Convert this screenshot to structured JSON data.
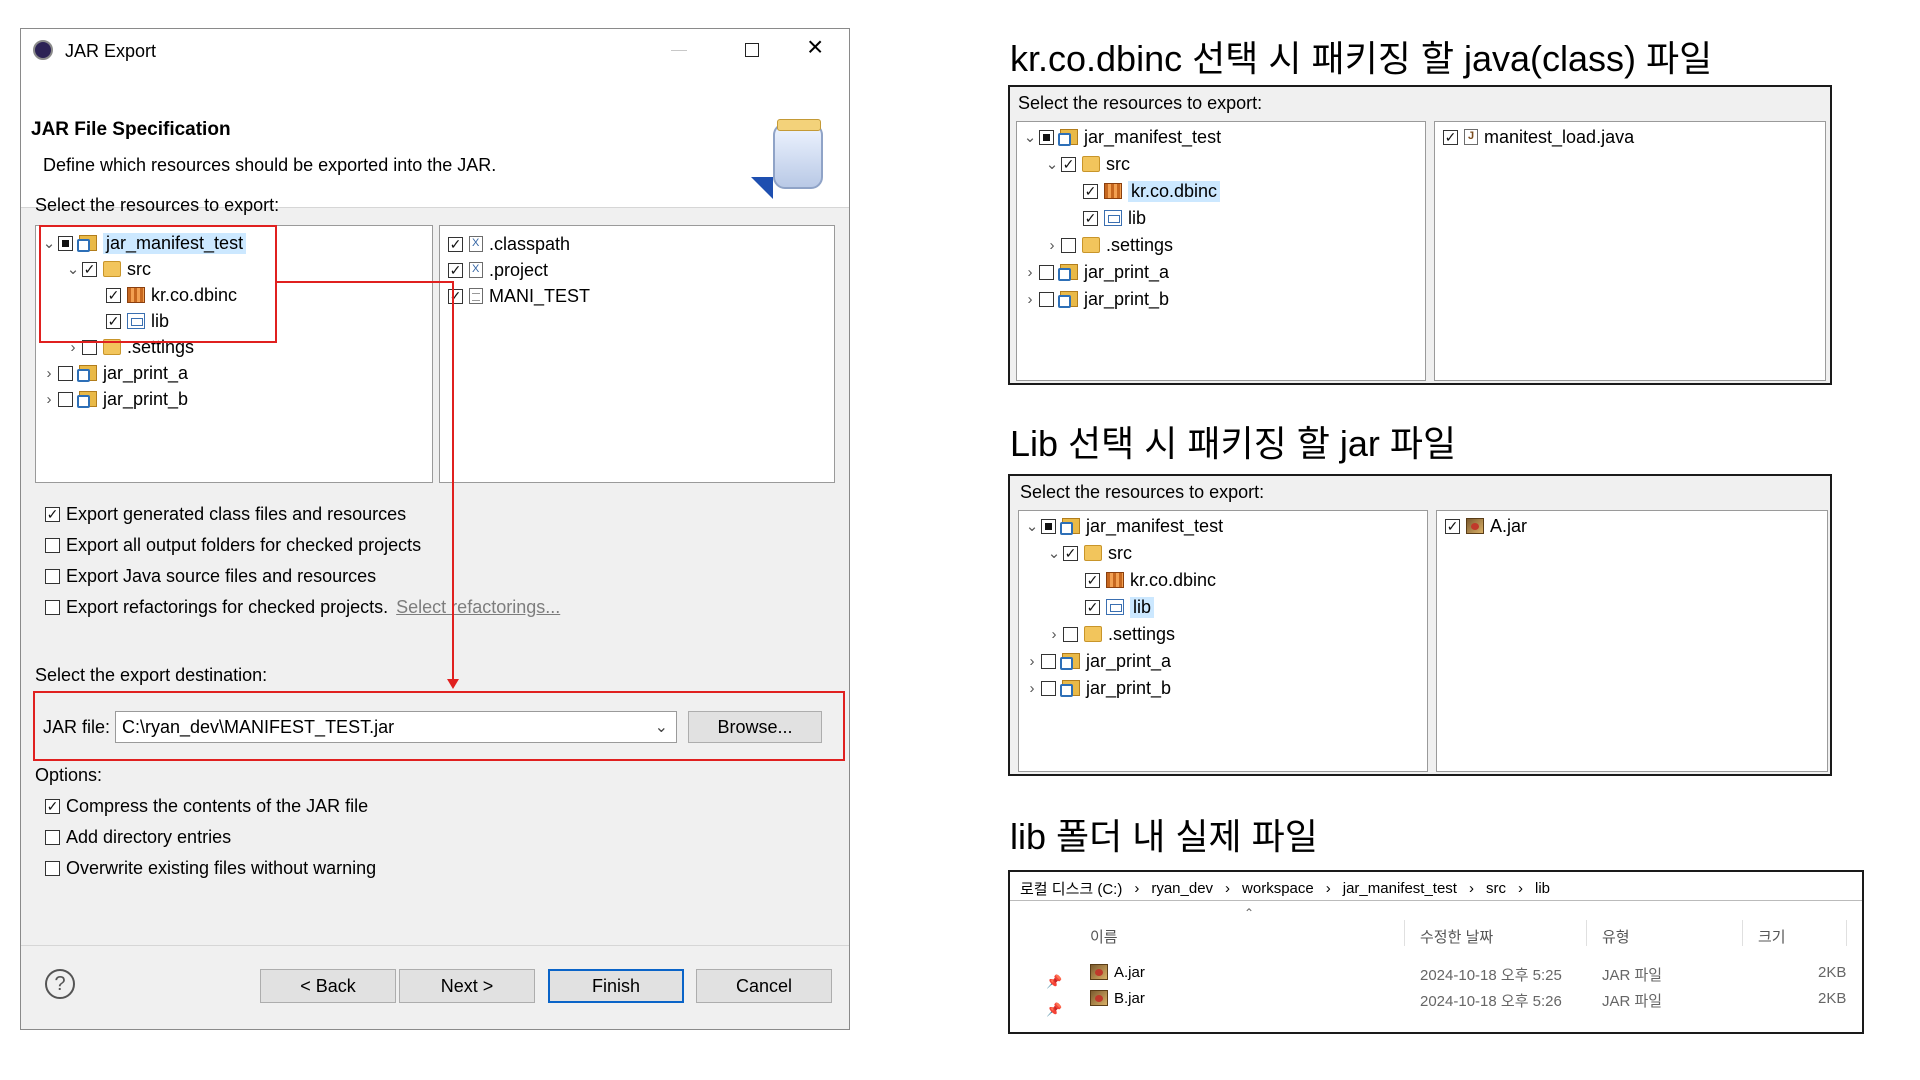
{
  "dialog": {
    "window_title": "JAR Export",
    "header_title": "JAR File Specification",
    "header_desc": "Define which resources should be exported into the JAR.",
    "select_label": "Select the resources to export:",
    "tree": [
      {
        "label": "jar_manifest_test",
        "state": "partial",
        "expand": "open"
      },
      {
        "label": "src",
        "state": "checked",
        "expand": "open"
      },
      {
        "label": "kr.co.dbinc",
        "state": "checked",
        "expand": "none"
      },
      {
        "label": "lib",
        "state": "checked",
        "expand": "none"
      },
      {
        "label": ".settings",
        "state": "unchecked",
        "expand": "closed"
      },
      {
        "label": "jar_print_a",
        "state": "unchecked",
        "expand": "closed"
      },
      {
        "label": "jar_print_b",
        "state": "unchecked",
        "expand": "closed"
      }
    ],
    "files": [
      ".classpath",
      ".project",
      "MANI_TEST"
    ],
    "opts1": [
      {
        "label": "Export generated class files and resources",
        "checked": true
      },
      {
        "label": "Export all output folders for checked projects",
        "checked": false
      },
      {
        "label": "Export Java source files and resources",
        "checked": false
      },
      {
        "label": "Export refactorings for checked projects.",
        "checked": false
      }
    ],
    "select_refactorings": "Select refactorings...",
    "dest_label": "Select the export destination:",
    "jar_file_label": "JAR file:",
    "jar_file_value": "C:\\ryan_dev\\MANIFEST_TEST.jar",
    "browse": "Browse...",
    "options_label": "Options:",
    "opts2": [
      {
        "label": "Compress the contents of the JAR file",
        "checked": true
      },
      {
        "label": "Add directory entries",
        "checked": false
      },
      {
        "label": "Overwrite existing files without warning",
        "checked": false
      }
    ],
    "back": "< Back",
    "next": "Next >",
    "finish": "Finish",
    "cancel": "Cancel"
  },
  "right": {
    "heading1": "kr.co.dbinc 선택 시 패키징 할 java(class) 파일",
    "heading2": "Lib 선택 시 패키징 할 jar 파일",
    "heading3": "lib 폴더 내 실제 파일",
    "select_label": "Select the resources to export:",
    "tree_labels": [
      "jar_manifest_test",
      "src",
      "kr.co.dbinc",
      "lib",
      ".settings",
      "jar_print_a",
      "jar_print_b"
    ],
    "panel1_file": "manitest_load.java",
    "panel2_file": "A.jar",
    "explorer": {
      "breadcrumb": [
        "로컬 디스크 (C:)",
        "ryan_dev",
        "workspace",
        "jar_manifest_test",
        "src",
        "lib"
      ],
      "columns": [
        "이름",
        "수정한 날짜",
        "유형",
        "크기"
      ],
      "rows": [
        {
          "name": "A.jar",
          "date": "2024-10-18 오후 5:25",
          "type": "JAR 파일",
          "size": "2KB"
        },
        {
          "name": "B.jar",
          "date": "2024-10-18 오후 5:26",
          "type": "JAR 파일",
          "size": "2KB"
        }
      ]
    }
  }
}
